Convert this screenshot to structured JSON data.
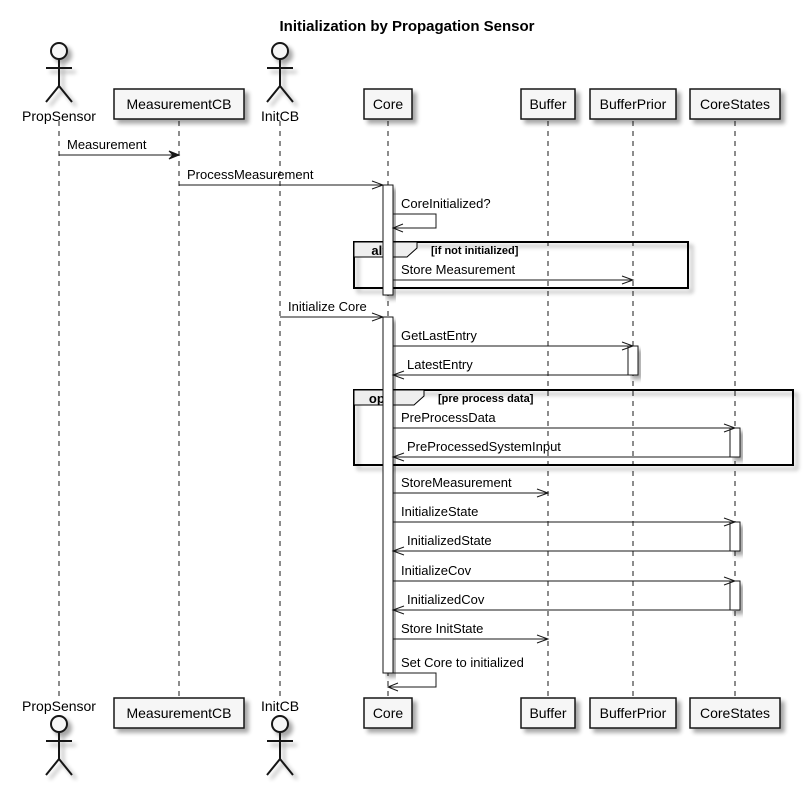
{
  "diagram": {
    "title": "Initialization by Propagation Sensor",
    "type": "sequence",
    "colors": {
      "participant_fill": "#f6f6f6",
      "line": "#181818",
      "frame_tab": "#eeeeee"
    },
    "participants": [
      {
        "id": "PropSensor",
        "label": "PropSensor",
        "kind": "actor"
      },
      {
        "id": "MeasurementCB",
        "label": "MeasurementCB",
        "kind": "participant"
      },
      {
        "id": "InitCB",
        "label": "InitCB",
        "kind": "actor"
      },
      {
        "id": "Core",
        "label": "Core",
        "kind": "participant"
      },
      {
        "id": "Buffer",
        "label": "Buffer",
        "kind": "participant"
      },
      {
        "id": "BufferPrior",
        "label": "BufferPrior",
        "kind": "participant"
      },
      {
        "id": "CoreStates",
        "label": "CoreStates",
        "kind": "participant"
      }
    ],
    "messages": [
      {
        "from": "PropSensor",
        "to": "MeasurementCB",
        "label": "Measurement",
        "style": "sync"
      },
      {
        "from": "MeasurementCB",
        "to": "Core",
        "label": "ProcessMeasurement",
        "style": "async"
      },
      {
        "from": "Core",
        "to": "Core",
        "label": "CoreInitialized?",
        "style": "self"
      },
      {
        "from": "Core",
        "to": "BufferPrior",
        "label": "Store Measurement",
        "style": "async"
      },
      {
        "from": "InitCB",
        "to": "Core",
        "label": "Initialize Core",
        "style": "async"
      },
      {
        "from": "Core",
        "to": "BufferPrior",
        "label": "GetLastEntry",
        "style": "async"
      },
      {
        "from": "BufferPrior",
        "to": "Core",
        "label": "LatestEntry",
        "style": "async"
      },
      {
        "from": "Core",
        "to": "CoreStates",
        "label": "PreProcessData",
        "style": "async"
      },
      {
        "from": "CoreStates",
        "to": "Core",
        "label": "PreProcessedSystemInput",
        "style": "async"
      },
      {
        "from": "Core",
        "to": "Buffer",
        "label": "StoreMeasurement",
        "style": "async"
      },
      {
        "from": "Core",
        "to": "CoreStates",
        "label": "InitializeState",
        "style": "async"
      },
      {
        "from": "CoreStates",
        "to": "Core",
        "label": "InitializedState",
        "style": "async"
      },
      {
        "from": "Core",
        "to": "CoreStates",
        "label": "InitializeCov",
        "style": "async"
      },
      {
        "from": "CoreStates",
        "to": "Core",
        "label": "InitializedCov",
        "style": "async"
      },
      {
        "from": "Core",
        "to": "Buffer",
        "label": "Store InitState",
        "style": "async"
      },
      {
        "from": "Core",
        "to": "Core",
        "label": "Set Core to initialized",
        "style": "self"
      }
    ],
    "fragments": [
      {
        "kind": "alt",
        "condition": "[if not initialized]",
        "first_message": 3,
        "last_message": 3
      },
      {
        "kind": "opt",
        "condition": "[pre process data]",
        "first_message": 7,
        "last_message": 8
      }
    ],
    "activations": [
      {
        "participant": "Core",
        "from_message": 1,
        "to_message": 3
      },
      {
        "participant": "Core",
        "from_message": 4,
        "to_message": 15
      },
      {
        "participant": "BufferPrior",
        "from_message": 5,
        "to_message": 6
      },
      {
        "participant": "CoreStates",
        "from_message": 7,
        "to_message": 8
      },
      {
        "participant": "CoreStates",
        "from_message": 10,
        "to_message": 11
      },
      {
        "participant": "CoreStates",
        "from_message": 12,
        "to_message": 13
      }
    ]
  }
}
